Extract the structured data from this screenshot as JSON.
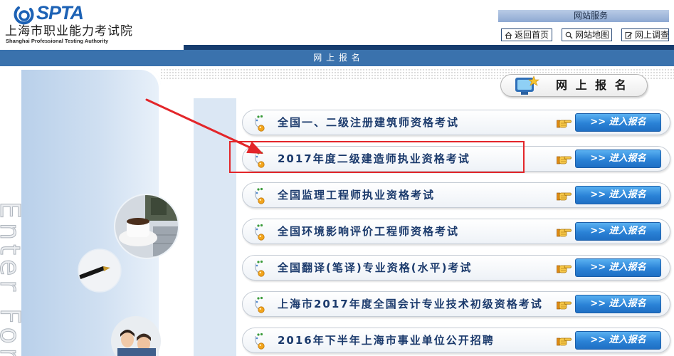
{
  "header": {
    "logo": {
      "mark_text": "SPTA",
      "icon": "spta-logo-icon"
    },
    "org_name_cn": "上海市职业能力考试院",
    "org_name_en": "Shanghai Professional Testing Authority",
    "services": {
      "title": "网站服务",
      "links": [
        {
          "label": "返回首页",
          "icon": "home-icon"
        },
        {
          "label": "网站地图",
          "icon": "search-icon"
        },
        {
          "label": "网上调查",
          "icon": "edit-icon"
        }
      ]
    }
  },
  "nav_bar": {
    "title": "网 上 报 名"
  },
  "side_panel": {
    "watermark_text": "Enter For"
  },
  "section": {
    "tab_label": "网 上 报 名",
    "tab_icon": "computer-icon",
    "exams": [
      {
        "title": "全国一、二级注册建筑师资格考试",
        "button_label": ">> 进入报名"
      },
      {
        "title": "2017年度二级建造师执业资格考试",
        "button_label": ">> 进入报名"
      },
      {
        "title": "全国监理工程师执业资格考试",
        "button_label": ">> 进入报名"
      },
      {
        "title": "全国环境影响评价工程师资格考试",
        "button_label": ">> 进入报名"
      },
      {
        "title": "全国翻译(笔译)专业资格(水平)考试",
        "button_label": ">> 进入报名"
      },
      {
        "title": "上海市2017年度全国会计专业技术初级资格考试",
        "button_label": ">> 进入报名"
      },
      {
        "title": "2016年下半年上海市事业单位公开招聘",
        "button_label": ">> 进入报名"
      }
    ]
  },
  "annotation": {
    "highlighted_exam_index": 1
  },
  "colors": {
    "brand_blue": "#1d62b5",
    "nav_blue": "#3a72ad",
    "row_text": "#1b3a6c",
    "button_blue": "#2a82d6",
    "annotation_red": "#e3262a"
  }
}
